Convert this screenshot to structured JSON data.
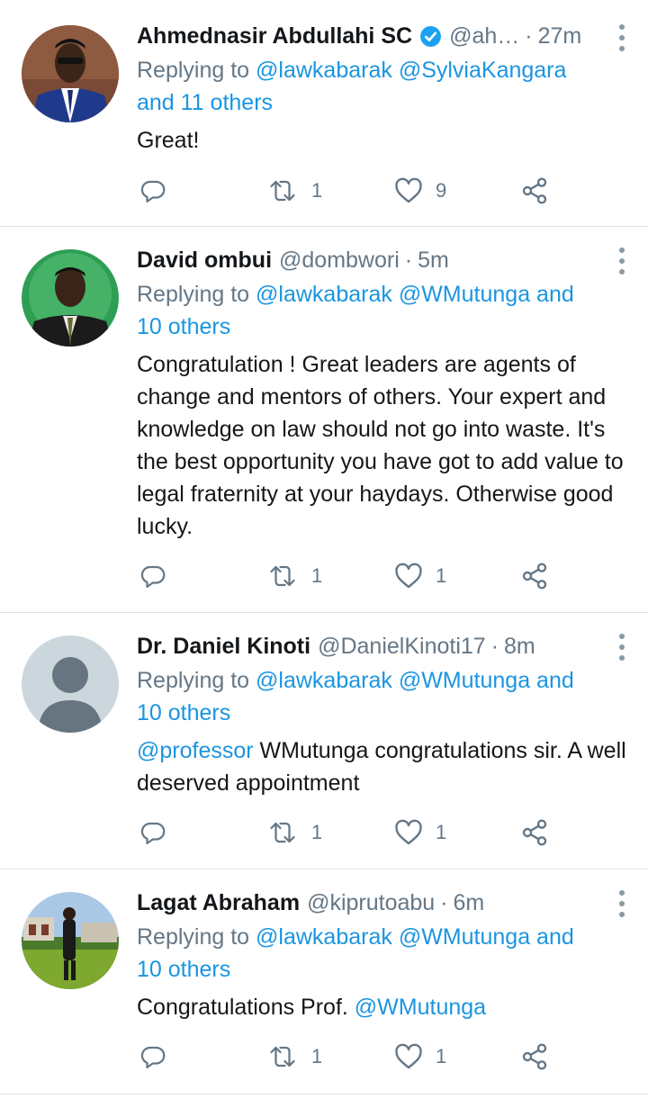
{
  "colors": {
    "link": "#1b95e0",
    "muted": "#657786",
    "divider": "#dfe3e6",
    "verified": "#1da1f2"
  },
  "icons": {
    "reply": "reply-icon",
    "retweet": "retweet-icon",
    "like": "like-icon",
    "share": "share-icon",
    "more": "more-icon",
    "verified": "verified-badge-icon"
  },
  "tweets": [
    {
      "name": "Ahmednasir Abdullahi SC",
      "verified": true,
      "handle": "@ah…",
      "dot": "·",
      "time": "27m",
      "replying_prefix": "Replying to",
      "reply_line1_links": [
        "@lawkabarak",
        "@SylviaKangara"
      ],
      "reply_line2": "and 11 others",
      "text": "Great!",
      "retweets": "1",
      "likes": "9"
    },
    {
      "name": "David ombui",
      "verified": false,
      "handle": "@dombwori",
      "dot": "·",
      "time": "5m",
      "replying_prefix": "Replying to",
      "reply_line1_links": [
        "@lawkabarak",
        "@WMutunga and"
      ],
      "reply_line2": "10 others",
      "text": "Congratulation ! Great leaders  are agents of change and mentors of others. Your expert and knowledge on law should not go into waste. It's the best opportunity you have got to add value to legal fraternity at your haydays. Otherwise good lucky.",
      "retweets": "1",
      "likes": "1"
    },
    {
      "name": "Dr. Daniel Kinoti",
      "verified": false,
      "handle": "@DanielKinoti17",
      "dot": "·",
      "time": "8m",
      "replying_prefix": "Replying to",
      "reply_line1_links": [
        "@lawkabarak",
        "@WMutunga and"
      ],
      "reply_line2": "10 others",
      "text_mention": "@professor",
      "text": " WMutunga congratulations sir. A well deserved appointment",
      "retweets": "1",
      "likes": "1"
    },
    {
      "name": "Lagat Abraham",
      "verified": false,
      "handle": "@kiprutoabu",
      "dot": "·",
      "time": "6m",
      "replying_prefix": "Replying to",
      "reply_line1_links": [
        "@lawkabarak",
        "@WMutunga and"
      ],
      "reply_line2": "10 others",
      "text": "Congratulations Prof. ",
      "text_mention_end": "@WMutunga",
      "retweets": "1",
      "likes": "1"
    }
  ]
}
